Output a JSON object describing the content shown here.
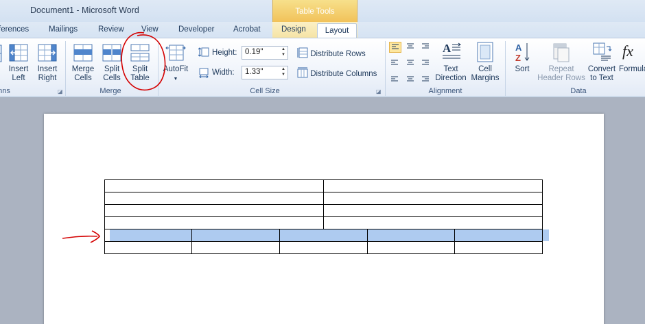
{
  "window": {
    "title": "Document1  -  Microsoft Word"
  },
  "contextual_tab_group": "Table Tools",
  "tabs": {
    "references": "ferences",
    "mailings": "Mailings",
    "review": "Review",
    "view": "View",
    "developer": "Developer",
    "acrobat": "Acrobat",
    "design": "Design",
    "layout": "Layout"
  },
  "ribbon": {
    "rows_columns": {
      "group_label": "nns",
      "insert_left": [
        "Insert",
        "Left"
      ],
      "insert_right": [
        "Insert",
        "Right"
      ]
    },
    "merge": {
      "group_label": "Merge",
      "merge_cells": [
        "Merge",
        "Cells"
      ],
      "split_cells": [
        "Split",
        "Cells"
      ],
      "split_table": [
        "Split",
        "Table"
      ]
    },
    "cell_size": {
      "group_label": "Cell Size",
      "autofit": "AutoFit",
      "height_label": "Height:",
      "height_value": "0.19\"",
      "width_label": "Width:",
      "width_value": "1.33\"",
      "distribute_rows": "Distribute Rows",
      "distribute_columns": "Distribute Columns"
    },
    "alignment": {
      "group_label": "Alignment",
      "text_direction": [
        "Text",
        "Direction"
      ],
      "cell_margins": [
        "Cell",
        "Margins"
      ]
    },
    "data": {
      "group_label": "Data",
      "sort": "Sort",
      "repeat_header_rows": [
        "Repeat",
        "Header Rows"
      ],
      "convert_to_text": [
        "Convert",
        "to Text"
      ],
      "formula": "Formula"
    }
  },
  "colors": {
    "selection": "#aecbf0",
    "annotation": "#d40000",
    "contextual": "#f1c25a"
  }
}
